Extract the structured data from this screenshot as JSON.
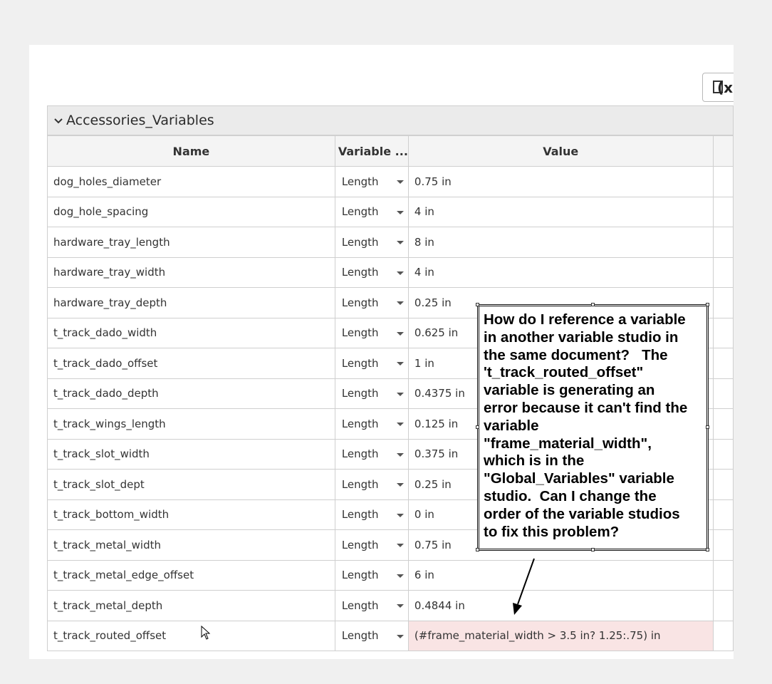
{
  "toolbar": {
    "fx_label": "(x)",
    "fx_icon": "function-variable-icon"
  },
  "section": {
    "title": "Accessories_Variables",
    "chevron_icon": "chevron-down-icon"
  },
  "table": {
    "headers": {
      "name": "Name",
      "type": "Variable ...",
      "value": "Value"
    },
    "rows": [
      {
        "name": "dog_holes_diameter",
        "type": "Length",
        "value": "0.75 in"
      },
      {
        "name": "dog_hole_spacing",
        "type": "Length",
        "value": "4 in"
      },
      {
        "name": "hardware_tray_length",
        "type": "Length",
        "value": "8 in"
      },
      {
        "name": "hardware_tray_width",
        "type": "Length",
        "value": "4 in"
      },
      {
        "name": "hardware_tray_depth",
        "type": "Length",
        "value": "0.25 in"
      },
      {
        "name": "t_track_dado_width",
        "type": "Length",
        "value": "0.625 in"
      },
      {
        "name": "t_track_dado_offset",
        "type": "Length",
        "value": "1 in"
      },
      {
        "name": "t_track_dado_depth",
        "type": "Length",
        "value": "0.4375 in"
      },
      {
        "name": "t_track_wings_length",
        "type": "Length",
        "value": "0.125 in"
      },
      {
        "name": "t_track_slot_width",
        "type": "Length",
        "value": "0.375 in"
      },
      {
        "name": "t_track_slot_dept",
        "type": "Length",
        "value": "0.25 in"
      },
      {
        "name": "t_track_bottom_width",
        "type": "Length",
        "value": "0 in"
      },
      {
        "name": "t_track_metal_width",
        "type": "Length",
        "value": "0.75 in"
      },
      {
        "name": "t_track_metal_edge_offset",
        "type": "Length",
        "value": "6 in"
      },
      {
        "name": "t_track_metal_depth",
        "type": "Length",
        "value": "0.4844 in"
      },
      {
        "name": "t_track_routed_offset",
        "type": "Length",
        "value": "(#frame_material_width > 3.5 in? 1.25:.75) in",
        "error": true
      }
    ]
  },
  "callout": {
    "lines": [
      "How do I reference a variable",
      "in another variable studio in",
      "the same document?   The",
      "'t_track_routed_offset\"",
      "variable is generating an",
      "error because it can't find the",
      "variable",
      "\"frame_material_width\",",
      "which is in the",
      "\"Global_Variables\" variable",
      "studio.  Can I change the",
      "order of the variable studios",
      "to fix this problem?"
    ]
  },
  "colors": {
    "error_bg": "#f9e4e4",
    "header_bg": "#f4f4f4",
    "section_bg": "#ebebeb",
    "border": "#cfcfcf"
  }
}
